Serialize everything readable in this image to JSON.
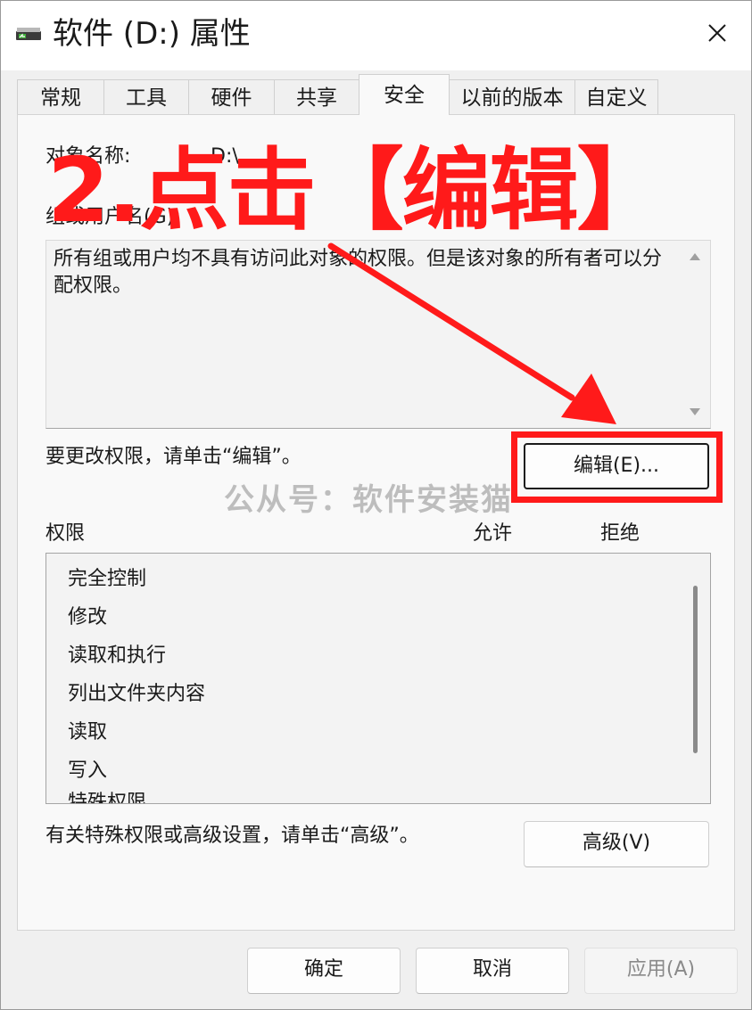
{
  "window": {
    "title": "软件 (D:) 属性",
    "close_label": "✕"
  },
  "tabs": [
    {
      "label": "常规"
    },
    {
      "label": "工具"
    },
    {
      "label": "硬件"
    },
    {
      "label": "共享"
    },
    {
      "label": "安全",
      "active": true
    },
    {
      "label": "以前的版本"
    },
    {
      "label": "自定义"
    }
  ],
  "security": {
    "object_name_label": "对象名称:",
    "object_name_value": "D:\\",
    "group_label": "组或用户名(G):",
    "info_text": "所有组或用户均不具有访问此对象的权限。但是该对象的所有者可以分配权限。",
    "edit_hint": "要更改权限，请单击“编辑”。",
    "edit_button": "编辑(E)...",
    "permissions_header": "权限",
    "allow_header": "允许",
    "deny_header": "拒绝",
    "permissions": [
      "完全控制",
      "修改",
      "读取和执行",
      "列出文件夹内容",
      "读取",
      "写入",
      "特殊权限"
    ],
    "advanced_hint": "有关特殊权限或高级设置，请单击“高级”。",
    "advanced_button": "高级(V)"
  },
  "footer": {
    "ok": "确定",
    "cancel": "取消",
    "apply": "应用(A)"
  },
  "overlay": {
    "annotation": "2.点击【编辑】",
    "watermark": "公从号：软件安装猫",
    "accent_color": "#ff1a1a"
  }
}
